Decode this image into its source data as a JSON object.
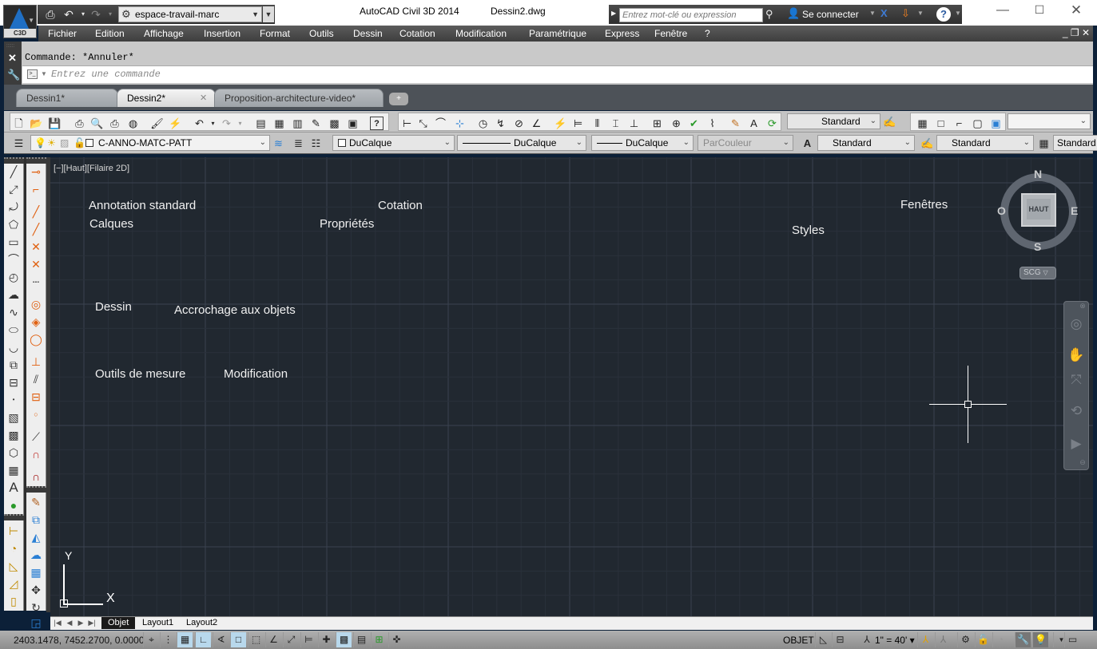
{
  "app": {
    "title": "AutoCAD Civil 3D 2014",
    "filename": "Dessin2.dwg",
    "logo_label": "C3D",
    "workspace": "espace-travail-marc",
    "search_placeholder": "Entrez mot-clé ou expression",
    "sign_in": "Se connecter",
    "min": "—",
    "max": "☐",
    "close": "✕"
  },
  "menu": [
    "Fichier",
    "Edition",
    "Affichage",
    "Insertion",
    "Format",
    "Outils",
    "Dessin",
    "Cotation",
    "Modification",
    "Paramétrique",
    "Express",
    "Fenêtre",
    "?"
  ],
  "command": {
    "history": "Commande: *Annuler*",
    "placeholder": "Entrez une commande",
    "prompt_icon": ">_"
  },
  "doc_tabs": [
    {
      "label": "Dessin1*",
      "active": false
    },
    {
      "label": "Dessin2*",
      "active": true
    },
    {
      "label": "Proposition-architecture-video*",
      "active": false
    }
  ],
  "toolbar2": {
    "layer": "C-ANNO-MATC-PATT",
    "color": "DuCalque",
    "linetype": "DuCalque",
    "lineweight": "DuCalque",
    "plotstyle": "ParCouleur",
    "text_style": "Standard",
    "dim_style": "Standard",
    "table_style": "Standard"
  },
  "toolbar1": {
    "dim_style_combo": "Standard",
    "viewport_combo": ""
  },
  "viewport": {
    "label": "[−][Haut][Filaire 2D]",
    "annotations": [
      {
        "text": "Annotation standard",
        "name": "label-annotation-standard"
      },
      {
        "text": "Calques",
        "name": "label-calques"
      },
      {
        "text": "Cotation",
        "name": "label-cotation"
      },
      {
        "text": "Propriétés",
        "name": "label-proprietes"
      },
      {
        "text": "Styles",
        "name": "label-styles"
      },
      {
        "text": "Fenêtres",
        "name": "label-fenetres"
      },
      {
        "text": "Dessin",
        "name": "label-dessin"
      },
      {
        "text": "Accrochage aux objets",
        "name": "label-accrochage"
      },
      {
        "text": "Outils de mesure",
        "name": "label-outils-mesure"
      },
      {
        "text": "Modification",
        "name": "label-modification"
      }
    ],
    "viewcube": {
      "face": "HAUT",
      "n": "N",
      "s": "S",
      "e": "E",
      "w": "O",
      "ucs": "SCG"
    },
    "ucs_x": "X",
    "ucs_y": "Y"
  },
  "layout_tabs": [
    {
      "label": "Objet",
      "active": true
    },
    {
      "label": "Layout1",
      "active": false
    },
    {
      "label": "Layout2",
      "active": false
    }
  ],
  "status": {
    "coords": "2403.1478, 7452.2700, 0.0000",
    "space": "OBJET",
    "annotation_scale": "1\" = 40'"
  }
}
